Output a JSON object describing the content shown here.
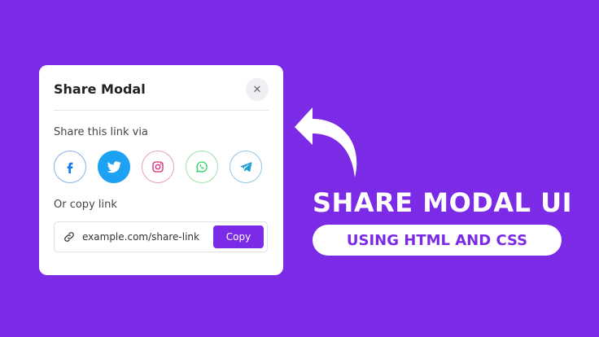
{
  "modal": {
    "title": "Share Modal",
    "close_icon": "close-icon",
    "share_label": "Share this link via",
    "social_icons": [
      "facebook-icon",
      "twitter-icon",
      "instagram-icon",
      "whatsapp-icon",
      "telegram-icon"
    ],
    "copy_label": "Or copy link",
    "link_value": "example.com/share-link",
    "copy_button": "Copy"
  },
  "banner": {
    "headline": "SHARE MODAL UI",
    "subheadline": "USING HTML AND CSS"
  },
  "colors": {
    "background": "#7b2ae6",
    "accent": "#7b2ae6",
    "twitter": "#1da1f2",
    "facebook": "#1877f2",
    "instagram": "#d62976",
    "whatsapp": "#25d366",
    "telegram": "#229ed9"
  }
}
